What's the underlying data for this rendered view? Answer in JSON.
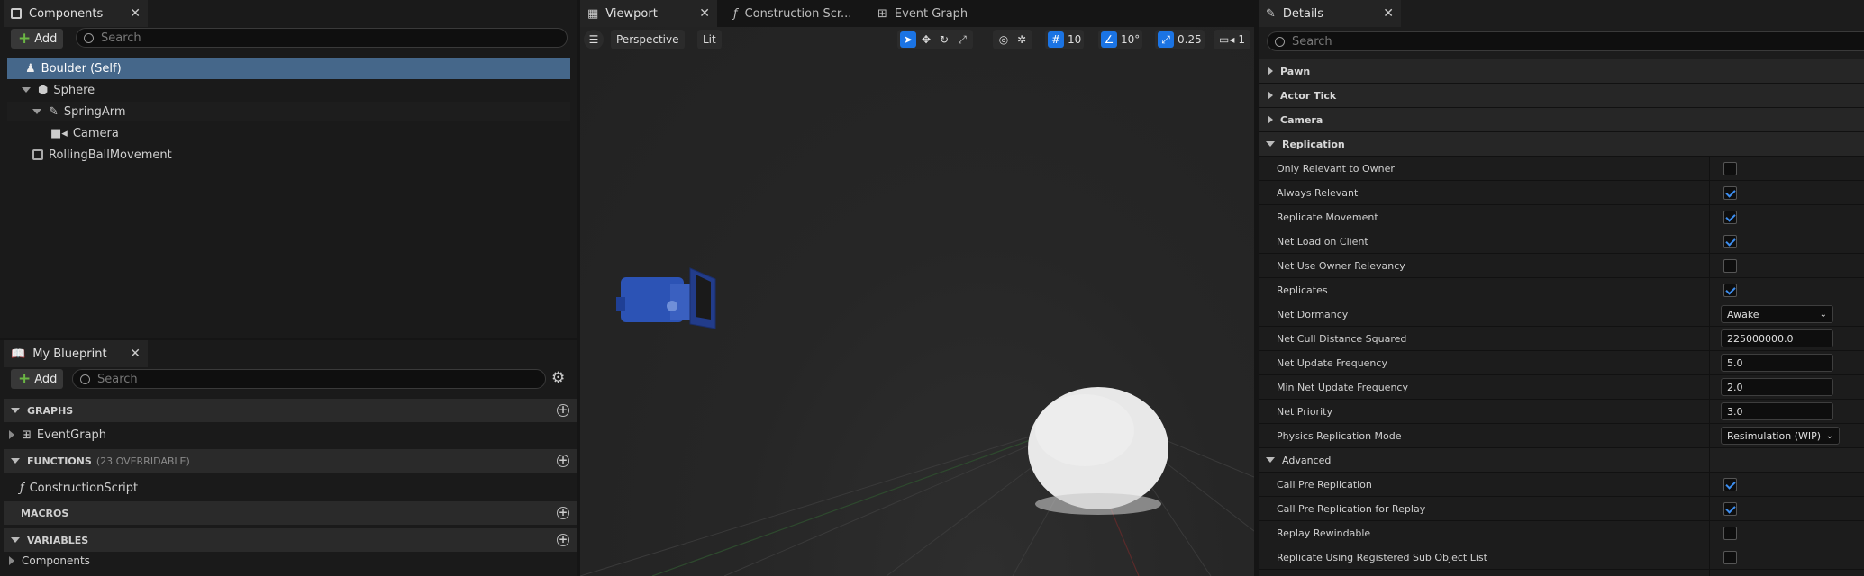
{
  "components_panel": {
    "tab_title": "Components",
    "add_label": "Add",
    "search_placeholder": "Search",
    "tree": [
      {
        "label": "Boulder (Self)",
        "icon": "pawn-icon"
      },
      {
        "label": "Sphere",
        "icon": "mesh-icon"
      },
      {
        "label": "SpringArm",
        "icon": "springarm-icon"
      },
      {
        "label": "Camera",
        "icon": "camera-icon"
      },
      {
        "label": "RollingBallMovement",
        "icon": "movement-component-icon"
      }
    ]
  },
  "my_blueprint": {
    "tab_title": "My Blueprint",
    "add_label": "Add",
    "search_placeholder": "Search",
    "graphs_label": "GRAPHS",
    "graph_item": "EventGraph",
    "functions_label": "FUNCTIONS",
    "functions_sub": "(23 OVERRIDABLE)",
    "function_item": "ConstructionScript",
    "macros_label": "MACROS",
    "variables_label": "VARIABLES",
    "variables_item": "Components"
  },
  "viewport": {
    "tabs": [
      {
        "label": "Viewport"
      },
      {
        "label": "Construction Scr..."
      },
      {
        "label": "Event Graph"
      }
    ],
    "perspective_label": "Perspective",
    "lit_label": "Lit",
    "grid_snap": "10",
    "rot_snap": "10°",
    "scale_snap": "0.25",
    "camera_speed": "1"
  },
  "details": {
    "tab_title": "Details",
    "search_placeholder": "Search",
    "categories": {
      "pawn": "Pawn",
      "actor_tick": "Actor Tick",
      "camera": "Camera",
      "replication": "Replication",
      "advanced": "Advanced"
    },
    "rows": {
      "only_relevant": "Only Relevant to Owner",
      "always_relevant": "Always Relevant",
      "replicate_movement": "Replicate Movement",
      "net_load": "Net Load on Client",
      "net_use_owner": "Net Use Owner Relevancy",
      "replicates": "Replicates",
      "net_dormancy": "Net Dormancy",
      "net_dormancy_value": "Awake",
      "net_cull": "Net Cull Distance Squared",
      "net_cull_value": "225000000.0",
      "net_update_freq": "Net Update Frequency",
      "net_update_freq_value": "5.0",
      "min_net_update": "Min Net Update Frequency",
      "min_net_update_value": "2.0",
      "net_priority": "Net Priority",
      "net_priority_value": "3.0",
      "physics_mode": "Physics Replication Mode",
      "physics_mode_value": "Resimulation (WIP)",
      "call_pre": "Call Pre Replication",
      "call_pre_replay": "Call Pre Replication for Replay",
      "replay_rewindable": "Replay Rewindable",
      "replicate_sub": "Replicate Using Registered Sub Object List"
    }
  },
  "colors": {
    "accent": "#1b74e4",
    "selection": "#45678a",
    "add_green": "#6bb644",
    "camera_blue": "#2c53b5"
  }
}
